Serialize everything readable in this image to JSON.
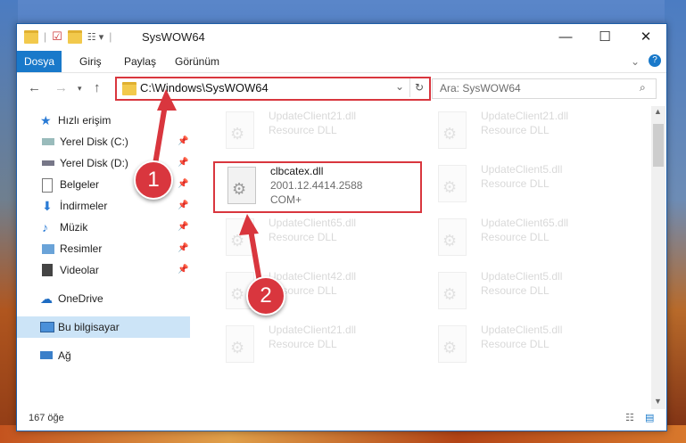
{
  "window": {
    "title": "SysWOW64"
  },
  "ribbon": {
    "tabs": [
      "Dosya",
      "Giriş",
      "Paylaş",
      "Görünüm"
    ]
  },
  "address": {
    "path": "C:\\Windows\\SysWOW64",
    "search_placeholder": "Ara: SysWOW64"
  },
  "sidebar": {
    "items": [
      {
        "label": "Hızlı erişim"
      },
      {
        "label": "Yerel Disk (C:)"
      },
      {
        "label": "Yerel Disk (D:)"
      },
      {
        "label": "Belgeler"
      },
      {
        "label": "İndirmeler"
      },
      {
        "label": "Müzik"
      },
      {
        "label": "Resimler"
      },
      {
        "label": "Videolar"
      },
      {
        "label": "OneDrive"
      },
      {
        "label": "Bu bilgisayar"
      },
      {
        "label": "Ağ"
      }
    ]
  },
  "files": [
    {
      "name": "UpdateClient21.dll",
      "type": "Resource DLL"
    },
    {
      "name": "UpdateClient21.dll",
      "type": "Resource DLL"
    },
    {
      "name": "clbcatex.dll",
      "version": "2001.12.4414.2588",
      "type": "COM+"
    },
    {
      "name": "UpdateClient5.dll",
      "type": "Resource DLL"
    },
    {
      "name": "UpdateClient65.dll",
      "type": "Resource DLL"
    },
    {
      "name": "UpdateClient65.dll",
      "type": "Resource DLL"
    },
    {
      "name": "UpdateClient42.dll",
      "type": "Resource DLL"
    },
    {
      "name": "UpdateClient5.dll",
      "type": "Resource DLL"
    },
    {
      "name": "UpdateClient21.dll",
      "type": "Resource DLL"
    },
    {
      "name": "UpdateClient5.dll",
      "type": "Resource DLL"
    }
  ],
  "status": {
    "count": "167 öğe"
  },
  "callouts": [
    "1",
    "2"
  ],
  "colors": {
    "accent": "#1979ca",
    "highlight": "#d9363e"
  }
}
